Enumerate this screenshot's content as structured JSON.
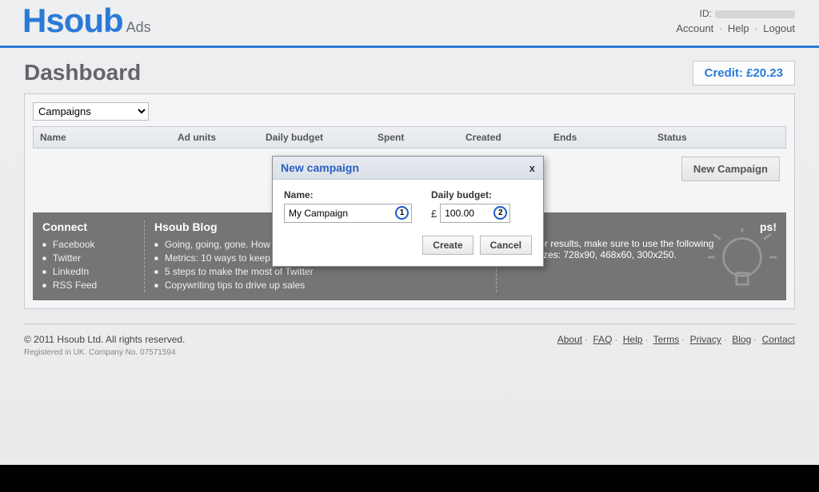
{
  "header": {
    "logo_main": "Hsoub",
    "logo_sub": "Ads",
    "id_label": "ID:",
    "account": "Account",
    "help": "Help",
    "logout": "Logout"
  },
  "page": {
    "title": "Dashboard",
    "credit_label": "Credit: £20.23"
  },
  "panel": {
    "dropdown_selected": "Campaigns",
    "columns": {
      "name": "Name",
      "ad_units": "Ad units",
      "daily_budget": "Daily budget",
      "spent": "Spent",
      "created": "Created",
      "ends": "Ends",
      "status": "Status"
    },
    "new_campaign_btn": "New Campaign"
  },
  "grey": {
    "connect": {
      "title": "Connect",
      "items": [
        "Facebook",
        "Twitter",
        "LinkedIn",
        "RSS Feed"
      ]
    },
    "blog": {
      "title": "Hsoub Blog",
      "items": [
        "Going, going, gone. How to use urgency marketing in your business",
        "Metrics: 10 ways to keep track?",
        "5 steps to make the most of Twitter",
        "Copywriting tips to drive up sales"
      ]
    },
    "tips": {
      "title": "ps!",
      "text1": "For better results, make sure to use the following",
      "text2": "Adunit sizes: 728x90, 468x60, 300x250."
    }
  },
  "footer": {
    "copyright": "© 2011 Hsoub Ltd. All rights reserved.",
    "legal": "Registered in UK. Company No. 07571594",
    "links": [
      "About",
      "FAQ",
      "Help",
      "Terms",
      "Privacy",
      "Blog",
      "Contact"
    ]
  },
  "modal": {
    "title": "New campaign",
    "close": "x",
    "name_label": "Name:",
    "name_value": "My Campaign",
    "budget_label": "Daily budget:",
    "budget_currency": "£",
    "budget_value": "100.00",
    "marker1": "1",
    "marker2": "2",
    "create": "Create",
    "cancel": "Cancel"
  }
}
